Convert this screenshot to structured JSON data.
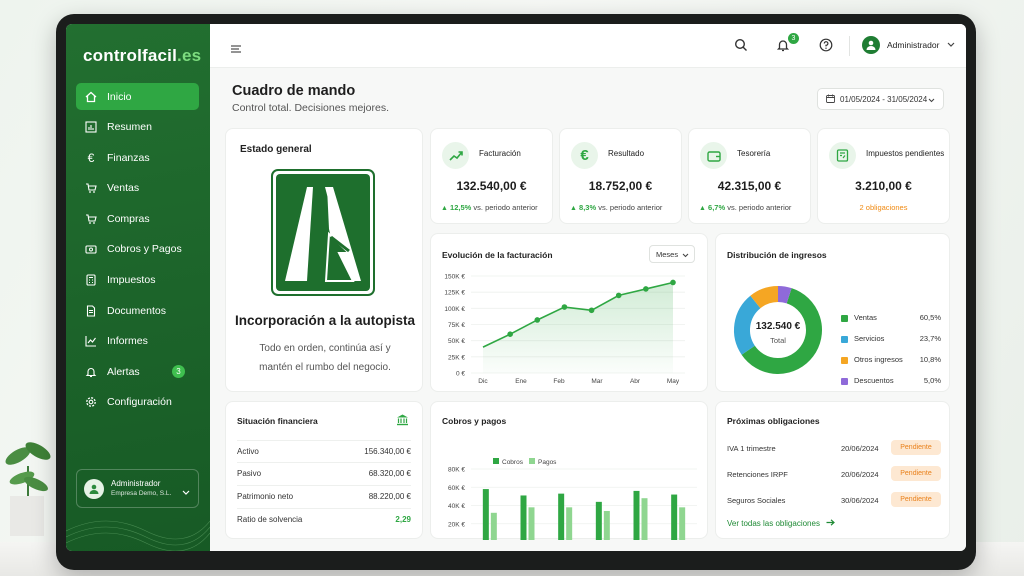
{
  "brand": {
    "name": "controlfacil",
    "tld": ".es"
  },
  "sidebar": {
    "items": [
      {
        "label": "Inicio",
        "icon": "home-icon",
        "active": true
      },
      {
        "label": "Resumen",
        "icon": "chart-bars-icon"
      },
      {
        "label": "Finanzas",
        "icon": "euro-icon"
      },
      {
        "label": "Ventas",
        "icon": "cart-icon"
      },
      {
        "label": "Compras",
        "icon": "shopping-cart-icon"
      },
      {
        "label": "Cobros y Pagos",
        "icon": "coins-icon"
      },
      {
        "label": "Impuestos",
        "icon": "calculator-icon"
      },
      {
        "label": "Documentos",
        "icon": "document-icon"
      },
      {
        "label": "Informes",
        "icon": "report-icon"
      },
      {
        "label": "Alertas",
        "icon": "bell-icon",
        "badge": "3"
      },
      {
        "label": "Configuración",
        "icon": "gear-icon"
      }
    ],
    "user": {
      "name": "Administrador",
      "company": "Empresa Demo, S.L."
    }
  },
  "topbar": {
    "notifications": "3",
    "user": "Administrador"
  },
  "header": {
    "title": "Cuadro de mando",
    "subtitle": "Control total. Decisiones mejores.",
    "date_range": "01/05/2024 - 31/05/2024"
  },
  "estado": {
    "title": "Estado general",
    "message": "Incorporación a la autopista",
    "description_line1": "Todo en orden, continúa así y",
    "description_line2": "mantén el rumbo del negocio."
  },
  "kpis": [
    {
      "label": "Facturación",
      "value": "132.540,00 €",
      "change": "12,5%",
      "note": "vs. periodo anterior",
      "icon": "trend-up-icon"
    },
    {
      "label": "Resultado",
      "value": "18.752,00 €",
      "change": "8,3%",
      "note": "vs. periodo anterior",
      "icon": "euro-icon"
    },
    {
      "label": "Tesorería",
      "value": "42.315,00 €",
      "change": "6,7%",
      "note": "vs. periodo anterior",
      "icon": "wallet-icon"
    },
    {
      "label": "Impuestos pendientes",
      "value": "3.210,00 €",
      "note": "2 obligaciones",
      "icon": "tax-document-icon"
    }
  ],
  "billing_chart": {
    "title": "Evolución de la facturación",
    "period_select": "Meses"
  },
  "income_chart": {
    "title": "Distribución de ingresos",
    "center_value": "132.540 €",
    "center_label": "Total"
  },
  "finance": {
    "title": "Situación financiera",
    "rows": [
      {
        "label": "Activo",
        "value": "156.340,00 €"
      },
      {
        "label": "Pasivo",
        "value": "68.320,00 €"
      },
      {
        "label": "Patrimonio neto",
        "value": "88.220,00 €"
      },
      {
        "label": "Ratio de solvencia",
        "value": "2,29"
      }
    ]
  },
  "cashflow_chart": {
    "title": "Cobros y pagos"
  },
  "obligations": {
    "title": "Próximas obligaciones",
    "rows": [
      {
        "name": "IVA 1 trimestre",
        "date": "20/06/2024",
        "status": "Pendiente"
      },
      {
        "name": "Retenciones IRPF",
        "date": "20/06/2024",
        "status": "Pendiente"
      },
      {
        "name": "Seguros Sociales",
        "date": "30/06/2024",
        "status": "Pendiente"
      }
    ],
    "link": "Ver todas las obligaciones"
  },
  "colors": {
    "brand_green": "#1d6b2c",
    "accent_green": "#2fa743",
    "light_green": "#8fd690",
    "blue": "#39a8d8",
    "orange": "#f5a623",
    "purple": "#8f6ad9",
    "warning": "#f08a12"
  },
  "chart_data": [
    {
      "type": "area",
      "title": "Evolución de la facturación",
      "categories": [
        "Dic",
        "Ene",
        "Feb",
        "Mar",
        "Abr",
        "May"
      ],
      "x": [
        "Dic",
        "Dic-Ene",
        "Ene-Feb",
        "Feb",
        "Mar",
        "Abr",
        "Abr-May",
        "May"
      ],
      "series": [
        {
          "values": [
            40000,
            60000,
            82000,
            102000,
            97000,
            120000,
            130000,
            140000
          ]
        }
      ],
      "ylim": [
        0,
        150000
      ],
      "yticks": [
        "150K €",
        "125K €",
        "100K €",
        "75K €",
        "50K €",
        "25K €",
        "0 €"
      ],
      "grid": true
    },
    {
      "type": "pie",
      "title": "Distribución de ingresos",
      "categories": [
        "Ventas",
        "Servicios",
        "Otros ingresos",
        "Descuentos"
      ],
      "values": [
        60.5,
        23.7,
        10.8,
        5.0
      ],
      "labels": [
        "60,5%",
        "23,7%",
        "10,8%",
        "5,0%"
      ],
      "legend": "right"
    },
    {
      "type": "bar",
      "title": "Cobros y pagos",
      "categories": [
        "Dic",
        "Ene",
        "Feb",
        "Mar",
        "Abr",
        "May"
      ],
      "series": [
        {
          "name": "Cobros",
          "values": [
            58000,
            51000,
            53000,
            44000,
            56000,
            52000
          ]
        },
        {
          "name": "Pagos",
          "values": [
            32000,
            38000,
            38000,
            34000,
            48000,
            38000
          ]
        }
      ],
      "ylim": [
        0,
        80000
      ],
      "yticks": [
        "80K €",
        "60K €",
        "40K €",
        "20K €",
        "0 €"
      ],
      "legend": "top-left"
    }
  ]
}
